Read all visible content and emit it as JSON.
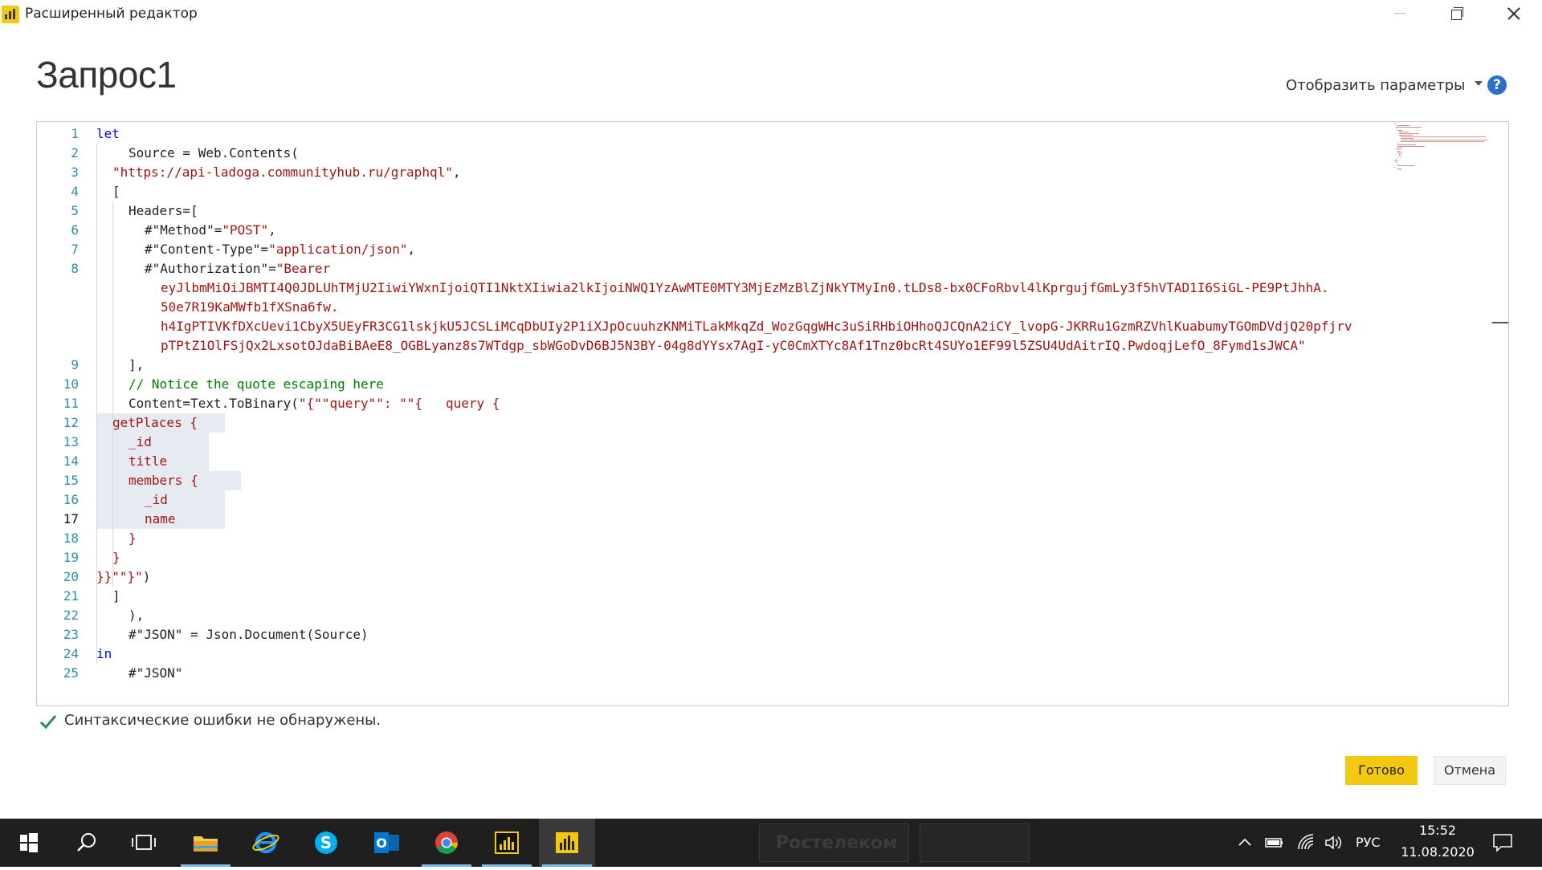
{
  "window": {
    "title": "Расширенный редактор",
    "icon": "power-bi-icon"
  },
  "header": {
    "query_title": "Запрос1",
    "display_params_label": "Отобразить параметры",
    "help_label": "?"
  },
  "editor": {
    "current_line": 17,
    "line_numbers": [
      "1",
      "2",
      "3",
      "4",
      "5",
      "6",
      "7",
      "8",
      "9",
      "10",
      "11",
      "12",
      "13",
      "14",
      "15",
      "16",
      "17",
      "18",
      "19",
      "20",
      "21",
      "22",
      "23",
      "24",
      "25"
    ],
    "lines": [
      [
        {
          "t": "let",
          "c": "kw"
        }
      ],
      [
        {
          "t": "Source = Web.Contents(",
          "c": ""
        }
      ],
      [
        {
          "t": "\"https://api-ladoga.communityhub.ru/graphql\"",
          "c": "str"
        },
        {
          "t": ",",
          "c": ""
        }
      ],
      [
        {
          "t": "[",
          "c": ""
        }
      ],
      [
        {
          "t": "Headers=[",
          "c": ""
        }
      ],
      [
        {
          "t": "#\"Method\"=",
          "c": ""
        },
        {
          "t": "\"POST\"",
          "c": "str"
        },
        {
          "t": ",",
          "c": ""
        }
      ],
      [
        {
          "t": "#\"Content-Type\"=",
          "c": ""
        },
        {
          "t": "\"application/json\"",
          "c": "str"
        },
        {
          "t": ",",
          "c": ""
        }
      ],
      [
        {
          "t": "#\"Authorization\"=",
          "c": ""
        },
        {
          "t": "\"Bearer",
          "c": "str"
        }
      ],
      [
        {
          "t": "eyJlbmMiOiJBMTI4Q0JDLUhTMjU2IiwiYWxnIjoiQTI1NktXIiwia2lkIjoiNWQ1YzAwMTE0MTY3MjEzMzBlZjNkYTMyIn0.tLDs8-bx0CFoRbvl4lKprgujfGmLy3f5hVTAD1I6SiGL-PE9PtJhhA.",
          "c": "str"
        }
      ],
      [
        {
          "t": "50e7R19KaMWfb1fXSna6fw.",
          "c": "str"
        }
      ],
      [
        {
          "t": "h4IgPTIVKfDXcUevi1CbyX5UEyFR3CG1lskjkU5JCSLiMCqDbUIy2P1iXJpOcuuhzKNMiTLakMkqZd_WozGqgWHc3uSiRHbiOHhoQJCQnA2iCY_lvopG-JKRRu1GzmRZVhlKuabumyTGOmDVdjQ20pfjrv",
          "c": "str"
        }
      ],
      [
        {
          "t": "pTPtZ1OlFSjQx2LxsotOJdaBiBAeE8_OGBLyanz8s7WTdgp_sbWGoDvD6BJ5N3BY-04g8dYYsx7AgI-yC0CmXTYc8Af1Tnz0bcRt4SUYo1EF99l5ZSU4UdAitrIQ.PwdoqjLefO_8Fymd1sJWCA\"",
          "c": "str"
        }
      ],
      [
        {
          "t": "],",
          "c": ""
        }
      ],
      [
        {
          "t": "// Notice the quote escaping here",
          "c": "cmt"
        }
      ],
      [
        {
          "t": "Content=Text.ToBinary(",
          "c": ""
        },
        {
          "t": "\"{\"\"query\"\": \"\"{   query {",
          "c": "str"
        }
      ],
      [
        {
          "t": "getPlaces {",
          "c": "str"
        }
      ],
      [
        {
          "t": "_id",
          "c": "str"
        }
      ],
      [
        {
          "t": "title",
          "c": "str"
        }
      ],
      [
        {
          "t": "members {",
          "c": "str"
        }
      ],
      [
        {
          "t": "_id",
          "c": "str"
        }
      ],
      [
        {
          "t": "name",
          "c": "str"
        }
      ],
      [
        {
          "t": "}",
          "c": "str"
        }
      ],
      [
        {
          "t": "}",
          "c": "str"
        }
      ],
      [
        {
          "t": "}}\"\"}\"",
          "c": "str"
        },
        {
          "t": ")",
          "c": ""
        }
      ],
      [
        {
          "t": "]",
          "c": ""
        }
      ],
      [
        {
          "t": "),",
          "c": ""
        }
      ],
      [
        {
          "t": "#\"JSON\" = Json.Document(Source)",
          "c": ""
        }
      ],
      [
        {
          "t": "in",
          "c": "kw"
        }
      ],
      [
        {
          "t": "#\"JSON\"",
          "c": ""
        }
      ]
    ]
  },
  "status": {
    "message": "Синтаксические ошибки не обнаружены.",
    "icon": "checkmark-icon",
    "color": "#2e8b57"
  },
  "buttons": {
    "ok_label": "Готово",
    "cancel_label": "Отмена"
  },
  "taskbar": {
    "items": [
      "windows-start-icon",
      "search-icon",
      "task-view-icon",
      "file-explorer-icon",
      "internet-explorer-icon",
      "skype-icon",
      "outlook-icon",
      "chrome-icon",
      "power-bi-icon",
      "power-bi-icon"
    ],
    "ghost_label": "Ростелеком",
    "language": "РУС",
    "time": "15:52",
    "date": "11.08.2020"
  },
  "colors": {
    "accent": "#f2c811",
    "keyword": "#0000ff",
    "string": "#a31515",
    "comment": "#008000",
    "line_number": "#2b91af"
  }
}
